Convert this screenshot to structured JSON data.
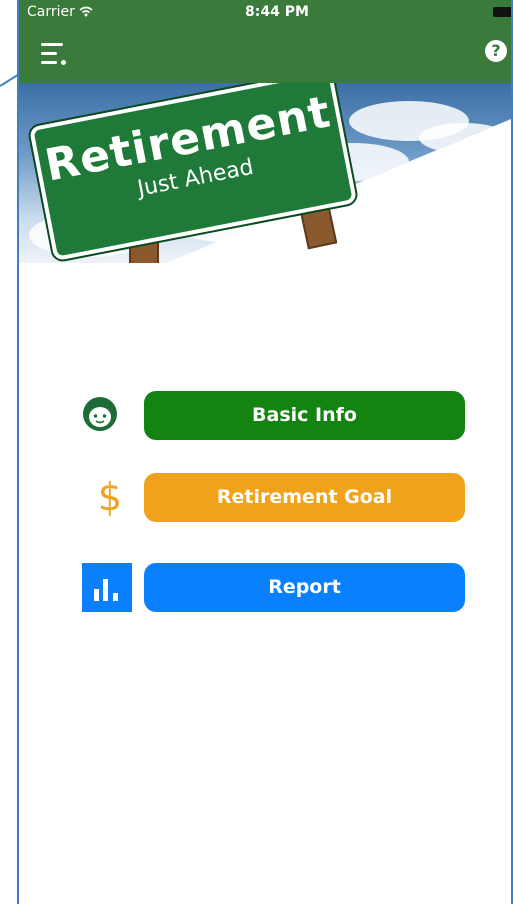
{
  "status_bar": {
    "carrier": "Carrier",
    "wifi_icon": "wifi-icon",
    "time": "8:44 PM",
    "battery_icon": "battery-icon"
  },
  "nav_bar": {
    "menu_icon": "menu-icon",
    "help_icon": "help-icon",
    "help_glyph": "?"
  },
  "hero": {
    "sign_title": "Retirement",
    "sign_subtitle": "Just Ahead"
  },
  "menu": [
    {
      "label": "Basic Info",
      "icon": "face-icon",
      "color": "#138311"
    },
    {
      "label": "Retirement Goal",
      "icon": "dollar-icon",
      "color": "#f0a31a"
    },
    {
      "label": "Report",
      "icon": "bar-chart-icon",
      "color": "#0a80ff"
    }
  ],
  "colors": {
    "nav_bar": "#3a7a3a",
    "frame": "#3f7fc4"
  },
  "dollar_glyph": "$"
}
